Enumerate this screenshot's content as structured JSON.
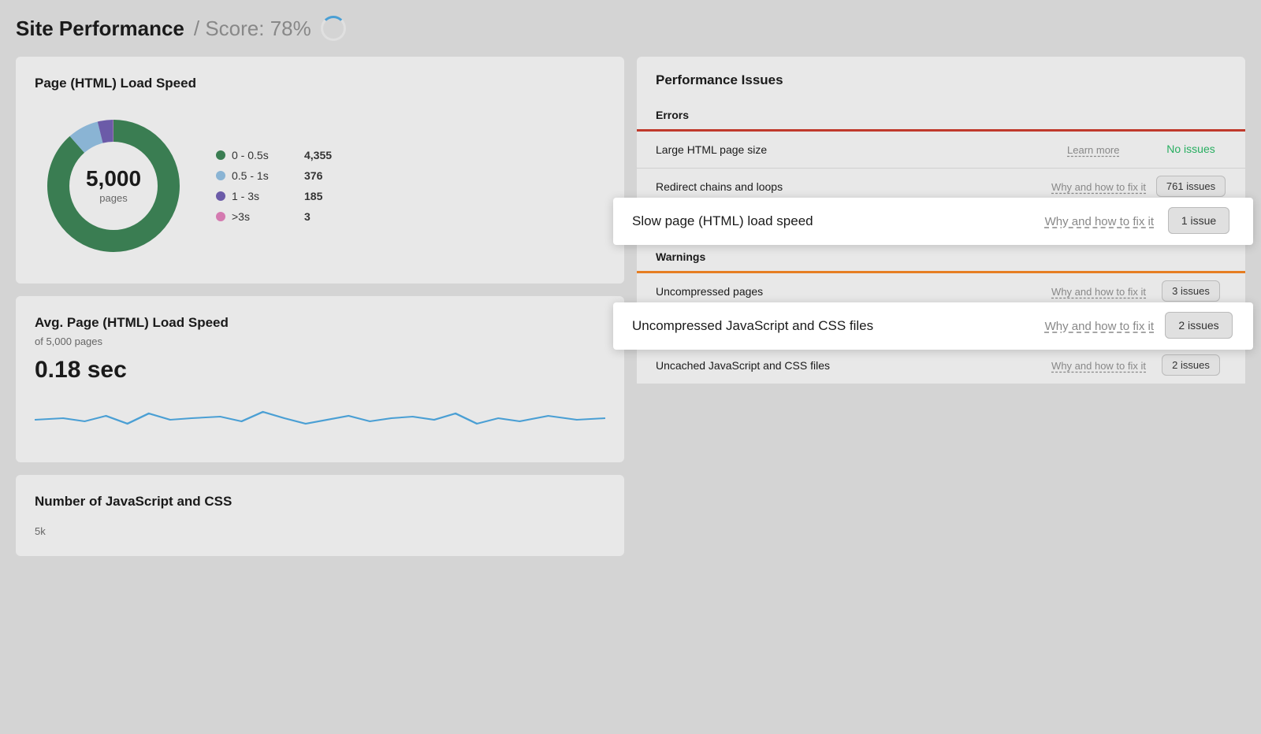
{
  "header": {
    "title": "Site Performance",
    "score_label": "/ Score: 78%"
  },
  "load_speed_card": {
    "title": "Page (HTML) Load Speed",
    "donut": {
      "center_number": "5,000",
      "center_label": "pages",
      "segments": [
        {
          "label": "0 - 0.5s",
          "count": "4,355",
          "color": "#3a7d52"
        },
        {
          "label": "0.5 - 1s",
          "count": "376",
          "color": "#8ab4d4"
        },
        {
          "label": "1 - 3s",
          "count": "185",
          "color": "#6b5ba8"
        },
        {
          "label": ">3s",
          "count": "3",
          "color": "#d47ab0"
        }
      ]
    }
  },
  "avg_speed_card": {
    "title": "Avg. Page (HTML) Load Speed",
    "subtitle": "of 5,000 pages",
    "value": "0.18 sec"
  },
  "js_css_card": {
    "title": "Number of JavaScript and CSS",
    "y_label": "5k"
  },
  "perf_issues_card": {
    "title": "Performance Issues",
    "errors_label": "Errors",
    "warnings_label": "Warnings",
    "errors": [
      {
        "name": "Large HTML page size",
        "link": "Learn more",
        "badge": "No issues",
        "badge_type": "no-issues"
      },
      {
        "name": "Redirect chains and loops",
        "link": "Why and how to fix it",
        "badge": "761 issues",
        "badge_type": "count"
      },
      {
        "name": "Slow page (HTML) load speed",
        "link": "Why and how to fix it",
        "badge": "1 issue",
        "badge_type": "count",
        "overlay": true
      }
    ],
    "warnings": [
      {
        "name": "Uncompressed pages",
        "link": "Why and how to fix it",
        "badge": "3 issues",
        "badge_type": "count"
      },
      {
        "name": "Uncompressed JavaScript and CSS files",
        "link": "Why and how to fix it",
        "badge": "2 issues",
        "badge_type": "count",
        "overlay": true
      },
      {
        "name": "Uncached JavaScript and CSS files",
        "link": "Why and how to fix it",
        "badge": "2 issues",
        "badge_type": "count"
      }
    ]
  }
}
